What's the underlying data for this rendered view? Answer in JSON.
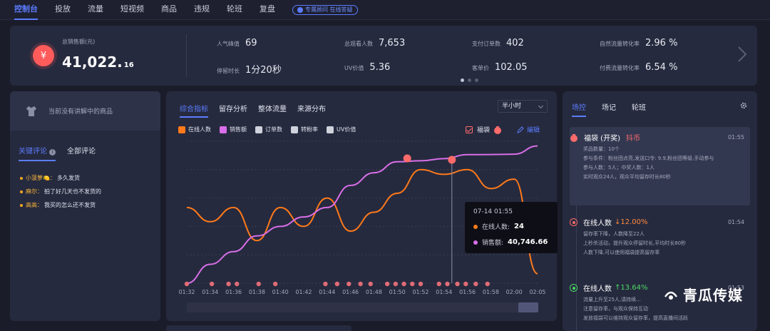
{
  "nav": {
    "items": [
      "控制台",
      "投放",
      "流量",
      "短视频",
      "商品",
      "违规",
      "轮班",
      "复盘"
    ],
    "active": 0,
    "consult": "专属顾问 在线答疑"
  },
  "summary": {
    "sales_label": "总销售额(元)",
    "sales_int": "41,022.",
    "sales_dec": "16",
    "metrics": [
      {
        "label": "人气峰值",
        "value": "69"
      },
      {
        "label": "总观看人数",
        "value": "7,653"
      },
      {
        "label": "支付订单数",
        "value": "402"
      },
      {
        "label": "自然流量转化率",
        "value": "2.96 %"
      },
      {
        "label": "停留时长",
        "value": "1分20秒"
      },
      {
        "label": "UV价值",
        "value": "5.36"
      },
      {
        "label": "客单价",
        "value": "102.05"
      },
      {
        "label": "付费流量转化率",
        "value": "6.54 %"
      }
    ]
  },
  "left": {
    "no_live": "当前没有讲解中的商品",
    "tabs": [
      "关键评论",
      "全部评论"
    ],
    "info_glyph": "i",
    "comments": [
      {
        "name": "小菠萝🍋：",
        "text": "多久发货"
      },
      {
        "name": "麻尔：",
        "text": "拍了好几天也不发货的"
      },
      {
        "name": "高高：",
        "text": "我买的怎么还不发货"
      }
    ]
  },
  "mid": {
    "tabs": [
      "综合指标",
      "留存分析",
      "整体流量",
      "来源分布"
    ],
    "select": "半小时",
    "legend": [
      {
        "label": "在线人数",
        "color": "#ff7a1a"
      },
      {
        "label": "销售额",
        "color": "#d86ee8"
      },
      {
        "label": "订单数",
        "color": "#cfd2dc"
      },
      {
        "label": "转粉率",
        "color": "#cfd2dc"
      },
      {
        "label": "UV价值",
        "color": "#cfd2dc"
      }
    ],
    "fudai": "福袋",
    "edit": "编辑",
    "tooltip": {
      "time": "07-14 01:55",
      "rows": [
        {
          "label": "在线人数:",
          "value": "24",
          "color": "#ff7a1a"
        },
        {
          "label": "销售额:",
          "value": "40,746.66",
          "color": "#d86ee8"
        }
      ]
    }
  },
  "chart_data": {
    "type": "line",
    "x": [
      "01:32",
      "01:34",
      "01:36",
      "01:38",
      "01:40",
      "01:42",
      "01:44",
      "01:46",
      "01:48",
      "01:50",
      "01:52",
      "01:54",
      "01:56",
      "01:58",
      "02:00",
      "02:05"
    ],
    "series": [
      {
        "name": "在线人数",
        "color": "#ff7a1a",
        "values": [
          16,
          13,
          16,
          9,
          16,
          12,
          18,
          11,
          15,
          19,
          24,
          23,
          24,
          20,
          22,
          2
        ]
      },
      {
        "name": "销售额",
        "color": "#d86ee8",
        "values": [
          0,
          6000,
          10000,
          15000,
          18000,
          21000,
          24000,
          31000,
          35000,
          38500,
          38800,
          39500,
          40746,
          40800,
          40900,
          43500
        ]
      }
    ]
  },
  "right": {
    "tabs": [
      "场控",
      "场记",
      "轮班"
    ],
    "events": [
      {
        "title": "福袋 (开奖)",
        "tag": "抖币",
        "time": "01:55",
        "lines": [
          "奖品数量：10个",
          "参与条件：粉丝团点亮,发送口令: 9.9,粉丝团等级,手动参与",
          "参与人数：5人；中奖人数：1人",
          "实时观众24人，观众平均留存时长80秒"
        ]
      },
      {
        "title": "在线人数",
        "delta": "↓12.00%",
        "time": "01:54",
        "lines": [
          "留存率下降，人数降至22人",
          "上秒杀活动，提升观众停留时长,平均时长80秒",
          "人数下降,可以使用福袋提高留存率"
        ]
      },
      {
        "title": "在线人数",
        "delta": "↑13.64%",
        "time": "01:53",
        "lines": [
          "流量上升至25人,请持续...",
          "注意留存率，与观众保持互动",
          "发放福袋可以维持观众留存率，提高直播间活跃"
        ]
      }
    ]
  },
  "brand": "青瓜传媒"
}
